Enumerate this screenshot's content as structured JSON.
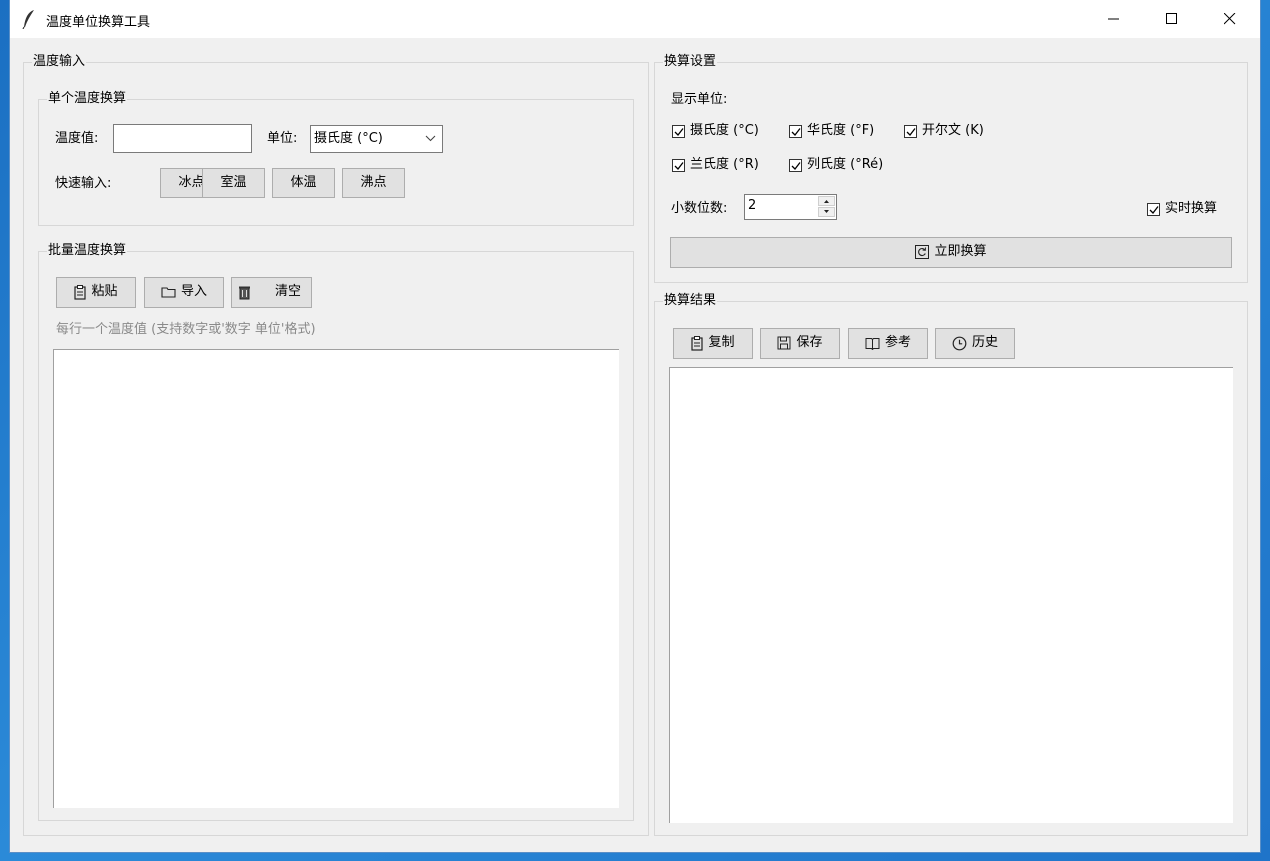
{
  "window": {
    "title": "温度单位换算工具",
    "controls": {
      "minimize": "minimize",
      "maximize": "maximize",
      "close": "close"
    }
  },
  "input_panel": {
    "title": "温度输入",
    "single": {
      "title": "单个温度换算",
      "temp_label": "温度值:",
      "temp_value": "",
      "unit_label": "单位:",
      "unit_selected": "摄氏度 (°C)",
      "quick_label": "快速输入:",
      "quick_buttons": [
        "冰点",
        "室温",
        "体温",
        "沸点"
      ]
    },
    "batch": {
      "title": "批量温度换算",
      "paste_label": "粘贴",
      "import_label": "导入",
      "clear_label": "清空",
      "hint": "每行一个温度值 (支持数字或'数字 单位'格式)",
      "content": ""
    }
  },
  "settings_panel": {
    "title": "换算设置",
    "display_units_label": "显示单位:",
    "units": [
      {
        "label": "摄氏度 (°C)",
        "checked": true
      },
      {
        "label": "华氏度 (°F)",
        "checked": true
      },
      {
        "label": "开尔文 (K)",
        "checked": true
      },
      {
        "label": "兰氏度 (°R)",
        "checked": true
      },
      {
        "label": "列氏度 (°Ré)",
        "checked": true
      }
    ],
    "decimals_label": "小数位数:",
    "decimals_value": "2",
    "realtime_label": "实时换算",
    "realtime_checked": true,
    "convert_label": "立即换算"
  },
  "results_panel": {
    "title": "换算结果",
    "copy_label": "复制",
    "save_label": "保存",
    "reference_label": "参考",
    "history_label": "历史",
    "content": ""
  }
}
